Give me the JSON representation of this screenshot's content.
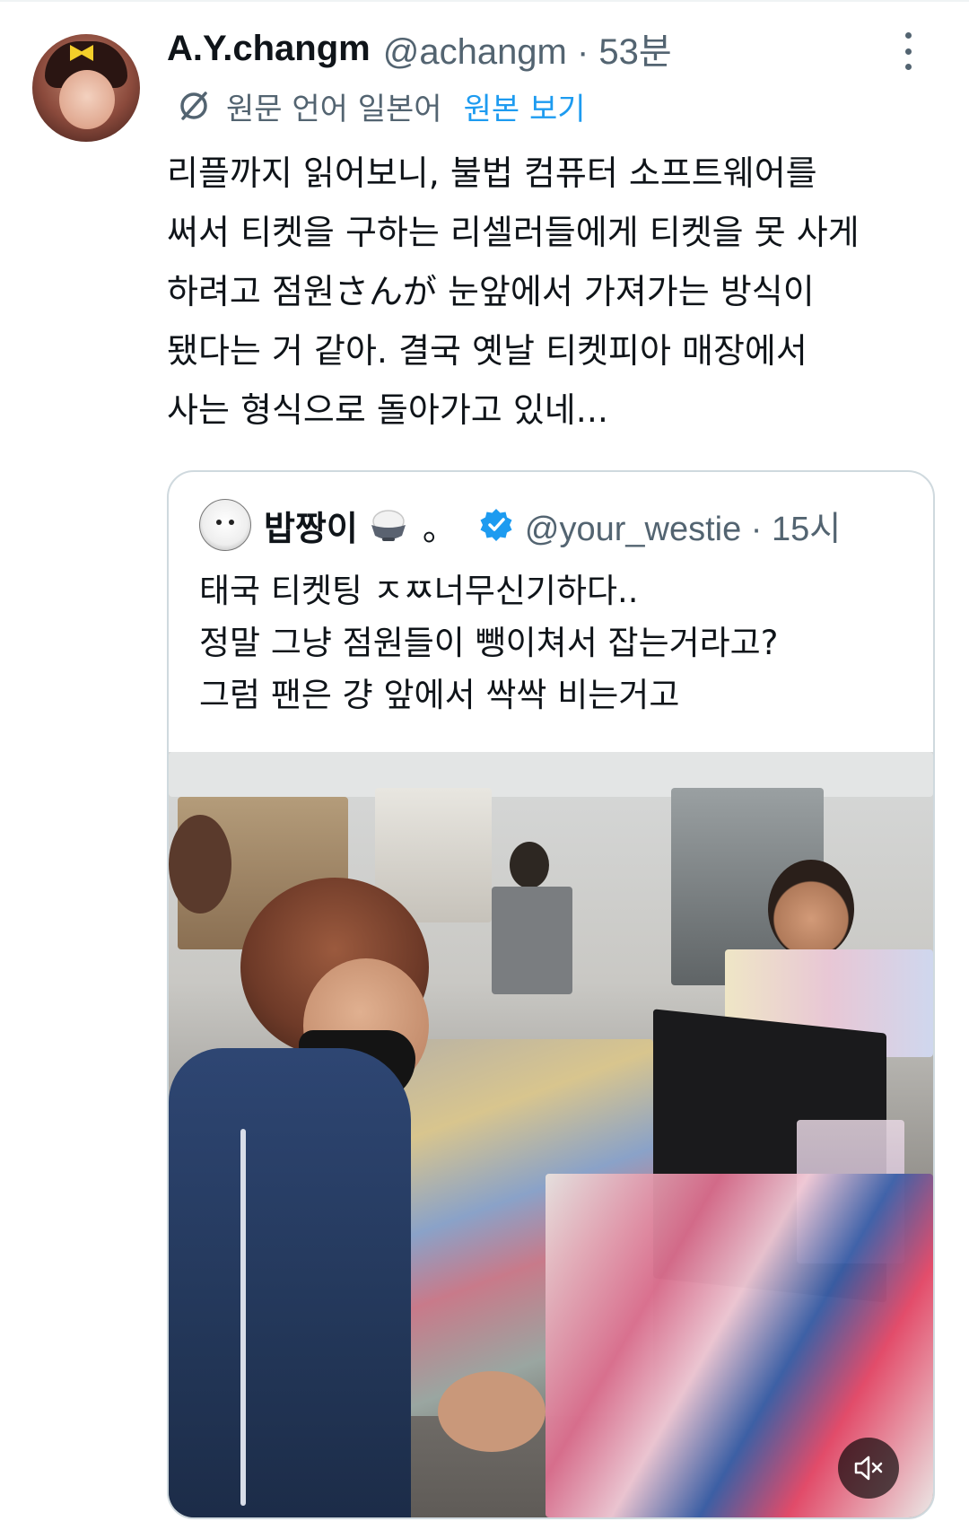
{
  "tweet": {
    "display_name": "A.Y.changm",
    "handle_time": "@achangm · 53분",
    "translation": {
      "language_note": "원문 언어 일본어",
      "view_original": "원본 보기"
    },
    "text_lines": [
      "리플까지 읽어보니, 불법 컴퓨터 소프트웨어를",
      "써서 티켓을 구하는 리셀러들에게 티켓을 못 사게",
      "하려고 점원さんが 눈앞에서 가져가는 방식이",
      "됐다는 거 같아. 결국 옛날 티켓피아 매장에서",
      "사는 형식으로 돌아가고 있네..."
    ]
  },
  "quote": {
    "display_name": "밥짱이",
    "name_suffix": "。",
    "handle_time": "@your_westie · 15시",
    "text_lines": [
      "태국 티켓팅 ㅈㅉ너무신기하다..",
      "정말 그냥 점원들이 뺑이쳐서 잡는거라고?",
      "그럼 팬은 걍 앞에서 싹싹 비는거고"
    ],
    "video": {
      "muted": true
    }
  },
  "colors": {
    "text_primary": "#0f1419",
    "text_secondary": "#536471",
    "link": "#1d9bf0",
    "border": "#cfd9de",
    "verified": "#1d9bf0"
  }
}
